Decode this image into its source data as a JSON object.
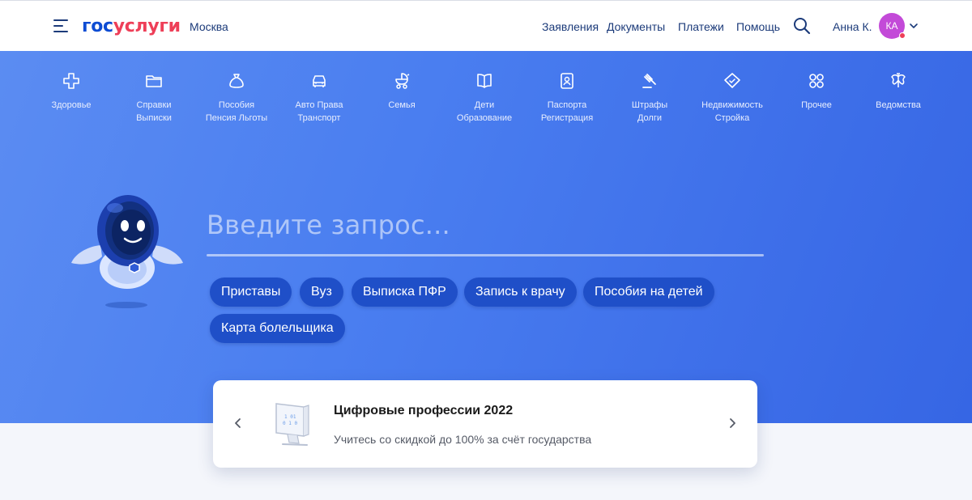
{
  "header": {
    "logo_part1": "гос",
    "logo_part2": "услуги",
    "city": "Москва",
    "nav": [
      "Заявления",
      "Документы",
      "Платежи",
      "Помощь"
    ],
    "user_name": "Анна К.",
    "avatar_initials": "КА"
  },
  "categories": [
    {
      "label1": "Здоровье",
      "label2": "",
      "icon": "medical-cross-icon"
    },
    {
      "label1": "Справки",
      "label2": "Выписки",
      "icon": "folder-icon"
    },
    {
      "label1": "Пособия",
      "label2": "Пенсия Льготы",
      "icon": "money-bag-icon"
    },
    {
      "label1": "Авто Права",
      "label2": "Транспорт",
      "icon": "car-icon"
    },
    {
      "label1": "Семья",
      "label2": "",
      "icon": "stroller-icon"
    },
    {
      "label1": "Дети",
      "label2": "Образование",
      "icon": "book-icon"
    },
    {
      "label1": "Паспорта",
      "label2": "Регистрация",
      "icon": "passport-icon"
    },
    {
      "label1": "Штрафы",
      "label2": "Долги",
      "icon": "gavel-icon"
    },
    {
      "label1": "Недвижимость",
      "label2": "Стройка",
      "icon": "house-icon"
    },
    {
      "label1": "Прочее",
      "label2": "",
      "icon": "grid-icon"
    },
    {
      "label1": "Ведомства",
      "label2": "",
      "icon": "coat-of-arms-icon"
    }
  ],
  "search": {
    "placeholder": "Введите запрос...",
    "chips": [
      "Приставы",
      "Вуз",
      "Выписка ПФР",
      "Запись к врачу",
      "Пособия на детей",
      "Карта болельщика"
    ]
  },
  "promo": {
    "title": "Цифровые профессии 2022",
    "subtitle": "Учитесь со скидкой до 100% за счёт государства"
  },
  "colors": {
    "brand_blue": "#0d4cd3",
    "brand_red": "#ee3f58",
    "hero_bg": "#4a7ef0",
    "chip_bg": "#1f4fc8",
    "avatar_bg": "#c34ad8"
  }
}
